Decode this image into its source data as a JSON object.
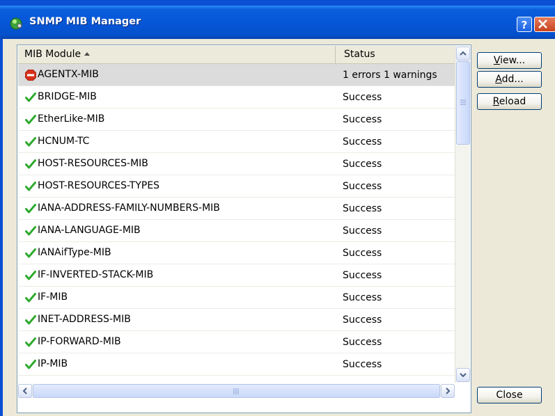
{
  "window": {
    "title": "SNMP MIB Manager"
  },
  "table": {
    "columns": {
      "module": "MIB Module",
      "status": "Status"
    },
    "rows": [
      {
        "name": "AGENTX-MIB",
        "status": "1 errors 1 warnings",
        "icon": "stop-error-icon",
        "selected": true
      },
      {
        "name": "BRIDGE-MIB",
        "status": "Success",
        "icon": "checkmark-icon"
      },
      {
        "name": "EtherLike-MIB",
        "status": "Success",
        "icon": "checkmark-icon"
      },
      {
        "name": "HCNUM-TC",
        "status": "Success",
        "icon": "checkmark-icon"
      },
      {
        "name": "HOST-RESOURCES-MIB",
        "status": "Success",
        "icon": "checkmark-icon"
      },
      {
        "name": "HOST-RESOURCES-TYPES",
        "status": "Success",
        "icon": "checkmark-icon"
      },
      {
        "name": "IANA-ADDRESS-FAMILY-NUMBERS-MIB",
        "status": "Success",
        "icon": "checkmark-icon"
      },
      {
        "name": "IANA-LANGUAGE-MIB",
        "status": "Success",
        "icon": "checkmark-icon"
      },
      {
        "name": "IANAifType-MIB",
        "status": "Success",
        "icon": "checkmark-icon"
      },
      {
        "name": "IF-INVERTED-STACK-MIB",
        "status": "Success",
        "icon": "checkmark-icon"
      },
      {
        "name": "IF-MIB",
        "status": "Success",
        "icon": "checkmark-icon"
      },
      {
        "name": "INET-ADDRESS-MIB",
        "status": "Success",
        "icon": "checkmark-icon"
      },
      {
        "name": "IP-FORWARD-MIB",
        "status": "Success",
        "icon": "checkmark-icon"
      },
      {
        "name": "IP-MIB",
        "status": "Success",
        "icon": "checkmark-icon"
      }
    ]
  },
  "buttons": {
    "view": {
      "mnemonic": "V",
      "rest": "iew..."
    },
    "add": {
      "mnemonic": "A",
      "rest": "dd..."
    },
    "reload": {
      "mnemonic": "R",
      "rest": "eload"
    },
    "close": "Close"
  },
  "colors": {
    "title_bar": "#0657d8",
    "dialog_bg": "#ece9d8",
    "check_green": "#2eaa2e",
    "error_red": "#d8301a",
    "selected_row": "#dcdcdc"
  }
}
